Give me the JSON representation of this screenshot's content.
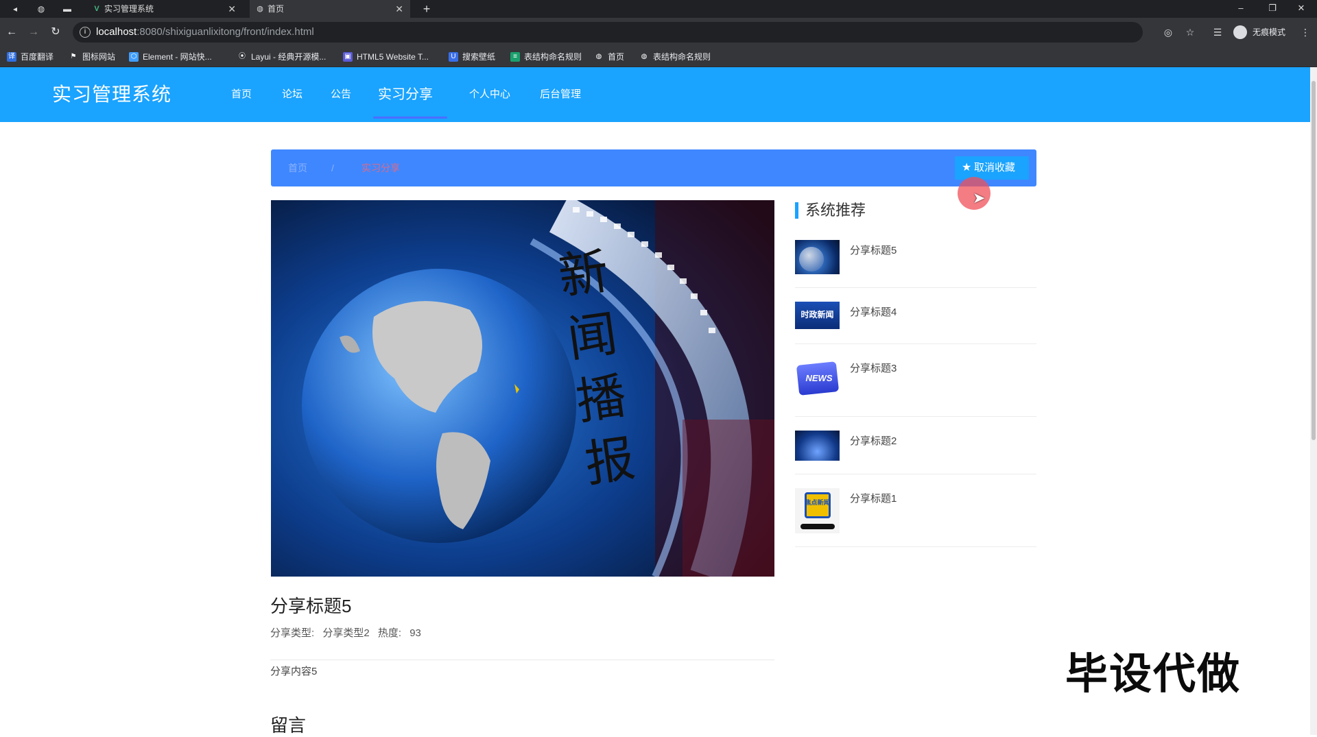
{
  "browser": {
    "tabs": [
      {
        "title": "实习管理系统",
        "active": false
      },
      {
        "title": "首页",
        "active": true
      }
    ],
    "new_tab": "+",
    "url_host": "localhost",
    "url_path": ":8080/shixiguanlixitong/front/index.html",
    "profile_label": "无痕模式",
    "bookmarks": [
      "百度翻译",
      "图标网站",
      "Element - 网站快...",
      "Layui - 经典开源模...",
      "HTML5 Website T...",
      "搜索壁纸",
      "表结构命名规则",
      "首页",
      "表结构命名规则"
    ]
  },
  "site": {
    "title": "实习管理系统",
    "nav": [
      "首页",
      "论坛",
      "公告",
      "实习分享",
      "个人中心",
      "后台管理"
    ],
    "active_nav_index": 3,
    "accent_color": "#1aa3ff"
  },
  "breadcrumb": {
    "home": "首页",
    "separator": "/",
    "current": "实习分享"
  },
  "favorite_button": {
    "label": "取消收藏",
    "icon": "star-icon"
  },
  "detail": {
    "image_text": [
      "新",
      "闻",
      "播",
      "报"
    ],
    "title": "分享标题5",
    "meta": {
      "type_label": "分享类型:",
      "type_value": "分享类型2",
      "heat_label": "热度:",
      "heat_value": "93"
    },
    "content": "分享内容5",
    "comments_title": "留言"
  },
  "sidebar": {
    "title": "系统推荐",
    "items": [
      {
        "label": "分享标题5",
        "thumb": "globe"
      },
      {
        "label": "分享标题4",
        "thumb": "时政新闻"
      },
      {
        "label": "分享标题3",
        "thumb": "NEWS"
      },
      {
        "label": "分享标题2",
        "thumb": "stage"
      },
      {
        "label": "分享标题1",
        "thumb": "焦点新闻"
      }
    ]
  },
  "watermark": "毕设代做"
}
